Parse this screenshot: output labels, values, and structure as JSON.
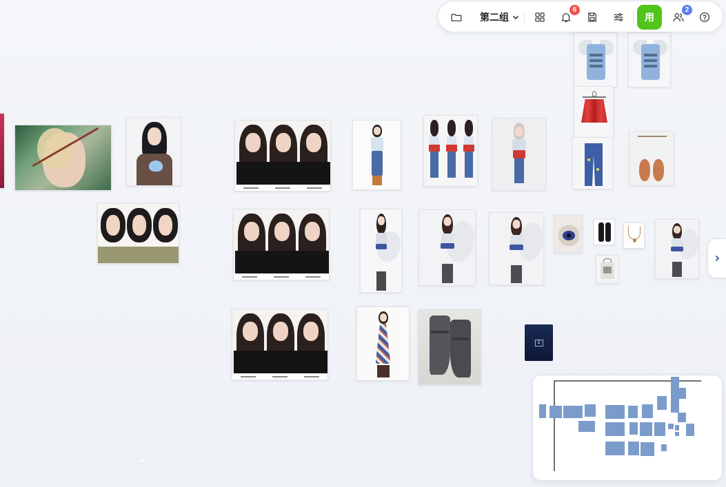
{
  "toolbar": {
    "group_name": "第二组",
    "notifications_count": "6",
    "collaborators_count": "2",
    "use_label": "用",
    "colors": {
      "accent_green": "#52c41a",
      "badge_red": "#f0524a",
      "badge_blue": "#5b7ef0"
    },
    "icons": [
      "folder-icon",
      "chevron-down-icon",
      "grid-icon",
      "bell-icon",
      "save-icon",
      "sliders-icon",
      "users-icon",
      "help-icon"
    ]
  },
  "canvas": {
    "cards": [
      {
        "name": "image-pink-partial"
      },
      {
        "name": "image-blonde-portrait"
      },
      {
        "name": "image-girl-heart-top"
      },
      {
        "name": "image-bangs-turnaround"
      },
      {
        "name": "model-sheet-1"
      },
      {
        "name": "model-sheet-2"
      },
      {
        "name": "model-sheet-3"
      },
      {
        "name": "outfit-jeans-front"
      },
      {
        "name": "outfit-turnaround"
      },
      {
        "name": "outfit-jeans-model"
      },
      {
        "name": "wing-top-1"
      },
      {
        "name": "wing-top-2"
      },
      {
        "name": "red-skirt"
      },
      {
        "name": "jeans-item"
      },
      {
        "name": "sandals"
      },
      {
        "name": "wings-outfit-1"
      },
      {
        "name": "wings-outfit-2"
      },
      {
        "name": "wings-outfit-3"
      },
      {
        "name": "eye-bag"
      },
      {
        "name": "gloves"
      },
      {
        "name": "necklace"
      },
      {
        "name": "shirt-hanger"
      },
      {
        "name": "wings-outfit-4"
      },
      {
        "name": "floral-dress"
      },
      {
        "name": "boots-closeup"
      },
      {
        "name": "ai-generate-chip"
      }
    ]
  },
  "side_panel": {
    "icon": "chevron-right-icon"
  },
  "minimap": {
    "label": "minimap"
  }
}
